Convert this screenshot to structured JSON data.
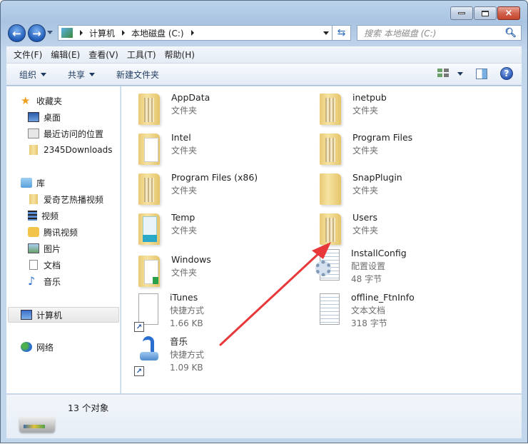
{
  "window": {
    "buttons": {
      "minimize": "minimize",
      "maximize": "maximize",
      "close": "×"
    }
  },
  "nav": {
    "back_icon": "←",
    "forward_icon": "→",
    "breadcrumb": [
      "计算机",
      "本地磁盘 (C:)"
    ],
    "search_placeholder": "搜索 本地磁盘 (C:)",
    "refresh_icon": "⇆",
    "search_icon": "⚲"
  },
  "menubar": [
    "文件(F)",
    "编辑(E)",
    "查看(V)",
    "工具(T)",
    "帮助(H)"
  ],
  "toolbar": {
    "organize": "组织",
    "share": "共享",
    "new_folder": "新建文件夹",
    "help_icon": "?"
  },
  "sidebar": {
    "favorites": {
      "label": "收藏夹",
      "items": [
        "桌面",
        "最近访问的位置",
        "2345Downloads"
      ]
    },
    "libraries": {
      "label": "库",
      "items": [
        "爱奇艺热播视频",
        "视频",
        "腾讯视频",
        "图片",
        "文档",
        "音乐"
      ]
    },
    "computer": "计算机",
    "network": "网络"
  },
  "files": [
    {
      "name": "AppData",
      "type": "文件夹"
    },
    {
      "name": "inetpub",
      "type": "文件夹"
    },
    {
      "name": "Intel",
      "type": "文件夹"
    },
    {
      "name": "Program Files",
      "type": "文件夹"
    },
    {
      "name": "Program Files (x86)",
      "type": "文件夹"
    },
    {
      "name": "SnapPlugin",
      "type": "文件夹"
    },
    {
      "name": "Temp",
      "type": "文件夹"
    },
    {
      "name": "Users",
      "type": "文件夹"
    },
    {
      "name": "Windows",
      "type": "文件夹"
    },
    {
      "name": "InstallConfig",
      "type": "配置设置",
      "size": "48 字节"
    },
    {
      "name": "iTunes",
      "type": "快捷方式",
      "size": "1.66 KB"
    },
    {
      "name": "offline_FtnInfo",
      "type": "文本文档",
      "size": "318 字节"
    },
    {
      "name": "音乐",
      "type": "快捷方式",
      "size": "1.09 KB"
    }
  ],
  "status": {
    "count": "13 个对象"
  },
  "colors": {
    "annotation_arrow": "#e8383a",
    "accent": "#2b56b4"
  }
}
